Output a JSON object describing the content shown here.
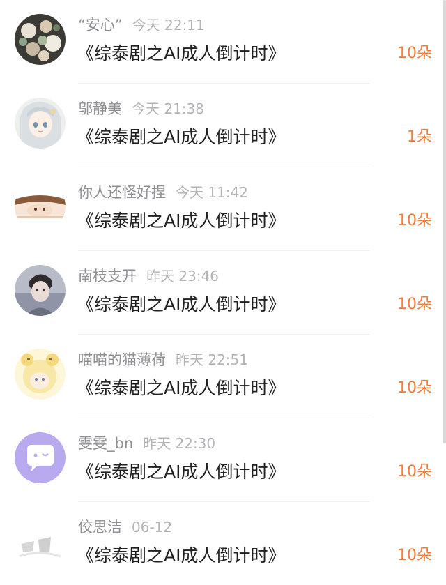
{
  "gift_list": [
    {
      "user": "“安心”",
      "time": "今天 22:11",
      "title": "《综泰剧之AI成人倒计时》",
      "count": "10朵",
      "avatar": "flower-bouquet-avatar"
    },
    {
      "user": "邬静美",
      "time": "今天 21:38",
      "title": "《综泰剧之AI成人倒计时》",
      "count": "1朵",
      "avatar": "anime-girl-avatar"
    },
    {
      "user": "你人还怪好捏",
      "time": "今天 11:42",
      "title": "《综泰剧之AI成人倒计时》",
      "count": "10朵",
      "avatar": "anime-boy-avatar"
    },
    {
      "user": "南枝支开",
      "time": "昨天 23:46",
      "title": "《综泰剧之AI成人倒计时》",
      "count": "10朵",
      "avatar": "photo-portrait-avatar"
    },
    {
      "user": "喵喵的猫薄荷",
      "time": "昨天 22:51",
      "title": "《综泰剧之AI成人倒计时》",
      "count": "10朵",
      "avatar": "cartoon-character-avatar"
    },
    {
      "user": "雯雯_bn",
      "time": "昨天 22:30",
      "title": "《综泰剧之AI成人倒计时》",
      "count": "10朵",
      "avatar": "chat-bubble-default-avatar"
    },
    {
      "user": "佼思洁",
      "time": "06-12",
      "title": "《综泰剧之AI成人倒计时》",
      "count": "10朵",
      "avatar": "faded-sketch-avatar"
    }
  ],
  "colors": {
    "count": "#ee7d3d",
    "name": "#8e8e93",
    "time": "#b4b4b8",
    "title": "#1f1f1f"
  }
}
